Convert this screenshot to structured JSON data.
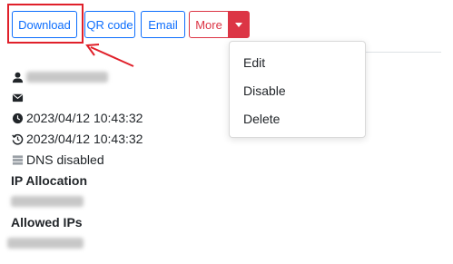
{
  "toolbar": {
    "download_label": "Download",
    "qr_label": "QR code",
    "email_label": "Email",
    "more_label": "More"
  },
  "dropdown": {
    "items": [
      "Edit",
      "Disable",
      "Delete"
    ]
  },
  "details": {
    "created": "2023/04/12 10:43:32",
    "updated": "2023/04/12 10:43:32",
    "dns": "DNS disabled",
    "ip_allocation_label": "IP Allocation",
    "allowed_ips_label": "Allowed IPs"
  },
  "colors": {
    "primary": "#0d6efd",
    "danger": "#dc3545",
    "highlight": "#e0202a"
  }
}
